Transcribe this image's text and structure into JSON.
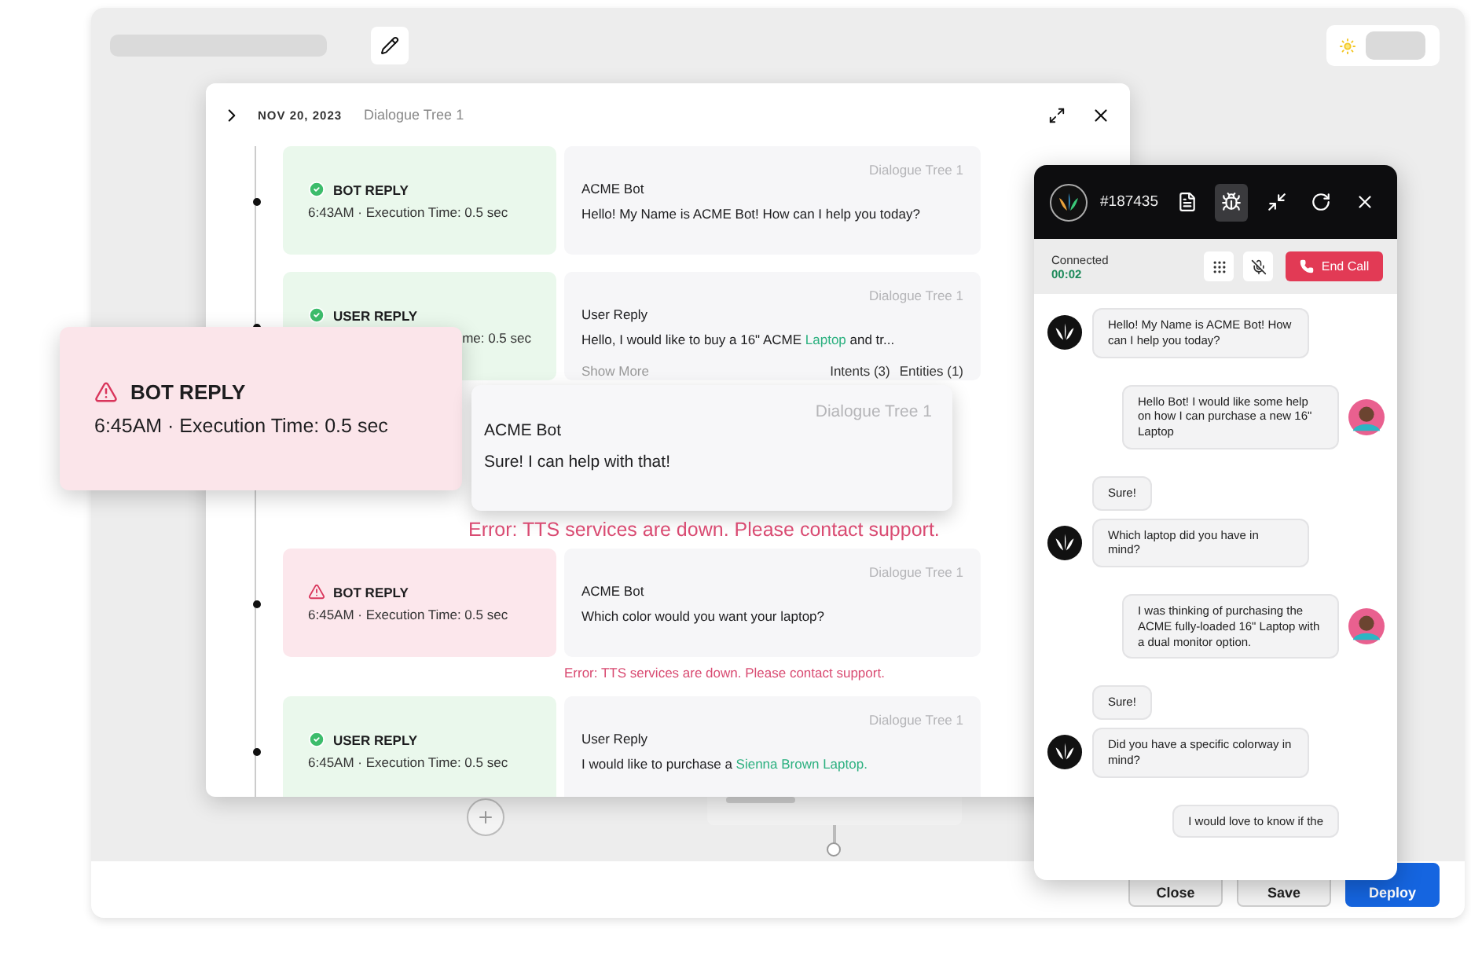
{
  "dialogue": {
    "date": "NOV 20, 2023",
    "title": "Dialogue Tree 1",
    "entries": [
      {
        "kind": "success",
        "label": "BOT REPLY",
        "meta": "6:43AM · Execution Time: 0.5 sec",
        "covered": false,
        "source": "Dialogue Tree 1",
        "speaker": "ACME Bot",
        "message": [
          {
            "text": "Hello! My Name is ACME Bot! How can I help you today?",
            "highlight": false
          }
        ]
      },
      {
        "kind": "success",
        "label": "USER REPLY",
        "meta": "me: 0.5 sec",
        "covered": true,
        "source": "Dialogue Tree 1",
        "speaker": "User Reply",
        "message": [
          {
            "text": "Hello, I would like to buy a 16\" ACME ",
            "highlight": false
          },
          {
            "text": "Laptop",
            "highlight": true
          },
          {
            "text": " and tr...",
            "highlight": false
          }
        ],
        "show_more": "Show More",
        "intents": "Intents (3)",
        "entities": "Entities (1)"
      },
      {
        "kind": "error",
        "label": "BOT REPLY",
        "meta": "6:45AM · Execution Time: 0.5 sec",
        "covered": false,
        "source": "Dialogue Tree 1",
        "speaker": "ACME Bot",
        "message": [
          {
            "text": "Which color would you want your laptop?",
            "highlight": false
          }
        ],
        "error": "Error: TTS services are down. Please contact support."
      },
      {
        "kind": "success",
        "label": "USER REPLY",
        "meta": "6:45AM · Execution Time: 0.5 sec",
        "covered": false,
        "source": "Dialogue Tree 1",
        "speaker": "User Reply",
        "message": [
          {
            "text": "I would like to purchase a ",
            "highlight": false
          },
          {
            "text": "Sienna Brown Laptop.",
            "highlight": true
          }
        ]
      }
    ]
  },
  "highlight": {
    "kind": "error",
    "label": "BOT REPLY",
    "meta": "6:45AM · Execution Time: 0.5 sec",
    "source": "Dialogue Tree 1",
    "speaker": "ACME Bot",
    "message": "Sure! I can help with that!",
    "error": "Error: TTS services are down. Please contact support."
  },
  "theme": {
    "dark": false
  },
  "chat": {
    "ticket": "#187435",
    "tools": [
      {
        "kind": "notes",
        "selected": false
      },
      {
        "kind": "debug",
        "selected": true
      },
      {
        "kind": "minimize",
        "selected": false
      },
      {
        "kind": "refresh",
        "selected": false
      },
      {
        "kind": "close",
        "selected": false
      }
    ],
    "status": "Connected",
    "timer": "00:02",
    "end_call": "End Call",
    "messages": [
      {
        "kind": "bot",
        "avatar": true,
        "text": "Hello! My Name is ACME Bot! How can I help you today?"
      },
      {
        "kind": "user",
        "avatar": true,
        "text": "Hello Bot! I would like some help on how I can purchase a new 16\" Laptop"
      },
      {
        "kind": "bot",
        "avatar": false,
        "text": "Sure!"
      },
      {
        "kind": "bot",
        "avatar": true,
        "text": "Which laptop did you have in mind?"
      },
      {
        "kind": "user",
        "avatar": true,
        "text": "I was thinking of purchasing the ACME fully-loaded 16\" Laptop with a dual monitor option."
      },
      {
        "kind": "bot",
        "avatar": false,
        "text": "Sure!"
      },
      {
        "kind": "bot",
        "avatar": true,
        "text": "Did you have a specific colorway in mind?"
      },
      {
        "kind": "user",
        "avatar": false,
        "text": "I would love to know if the"
      }
    ]
  },
  "footer": {
    "buttons": [
      {
        "label": "Close",
        "kind": "secondary"
      },
      {
        "label": "Save",
        "kind": "secondary"
      },
      {
        "label": "Deploy",
        "kind": "primary"
      }
    ]
  }
}
